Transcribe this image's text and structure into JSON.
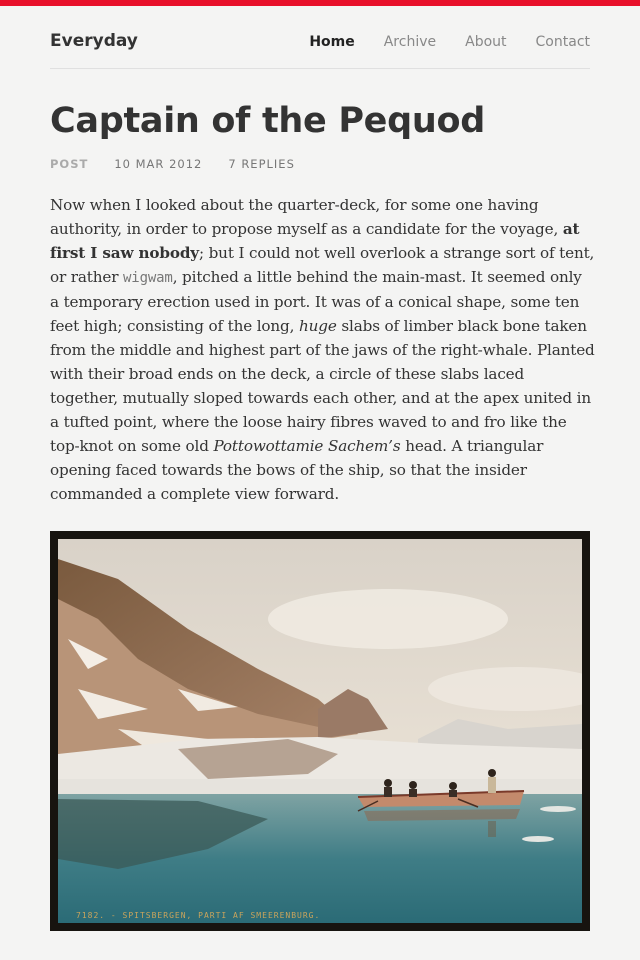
{
  "colors": {
    "accent_bar": "#e8102a",
    "text": "#333333"
  },
  "site": {
    "title": "Everyday"
  },
  "nav": {
    "items": [
      {
        "label": "Home",
        "active": true
      },
      {
        "label": "Archive",
        "active": false
      },
      {
        "label": "About",
        "active": false
      },
      {
        "label": "Contact",
        "active": false
      }
    ]
  },
  "post": {
    "title": "Captain of the Pequod",
    "type": "POST",
    "date": "10 MAR 2012",
    "replies": "7 REPLIES",
    "body": {
      "p1": "Now when I looked about the quarter-deck, for some one having authority, in order to propose myself as a candidate for the voyage, ",
      "bold": "at first I saw nobody",
      "p2": "; but I could not well overlook a strange sort of tent, or rather ",
      "code": "wigwam",
      "p3": ", pitched a little behind the main-mast. It seemed only a temporary erection used in port. It was of a conical shape, some ten feet high; consisting of the long, ",
      "em1": "huge",
      "p4": " slabs of limber black bone taken from the middle and highest part of the jaws of the right-whale. Planted with their broad ends on the deck, a circle of these slabs laced together, mutually sloped towards each other, and at the apex united in a tufted point, where the loose hairy fibres waved to and fro like the top-knot on some old ",
      "em2": "Pottowottamie Sachem’s",
      "p5": " head. A triangular opening faced towards the bows of the ship, so that the insider commanded a complete view forward."
    },
    "image_caption": "7182. - SPITSBERGEN, PARTI AF SMEERENBURG."
  }
}
